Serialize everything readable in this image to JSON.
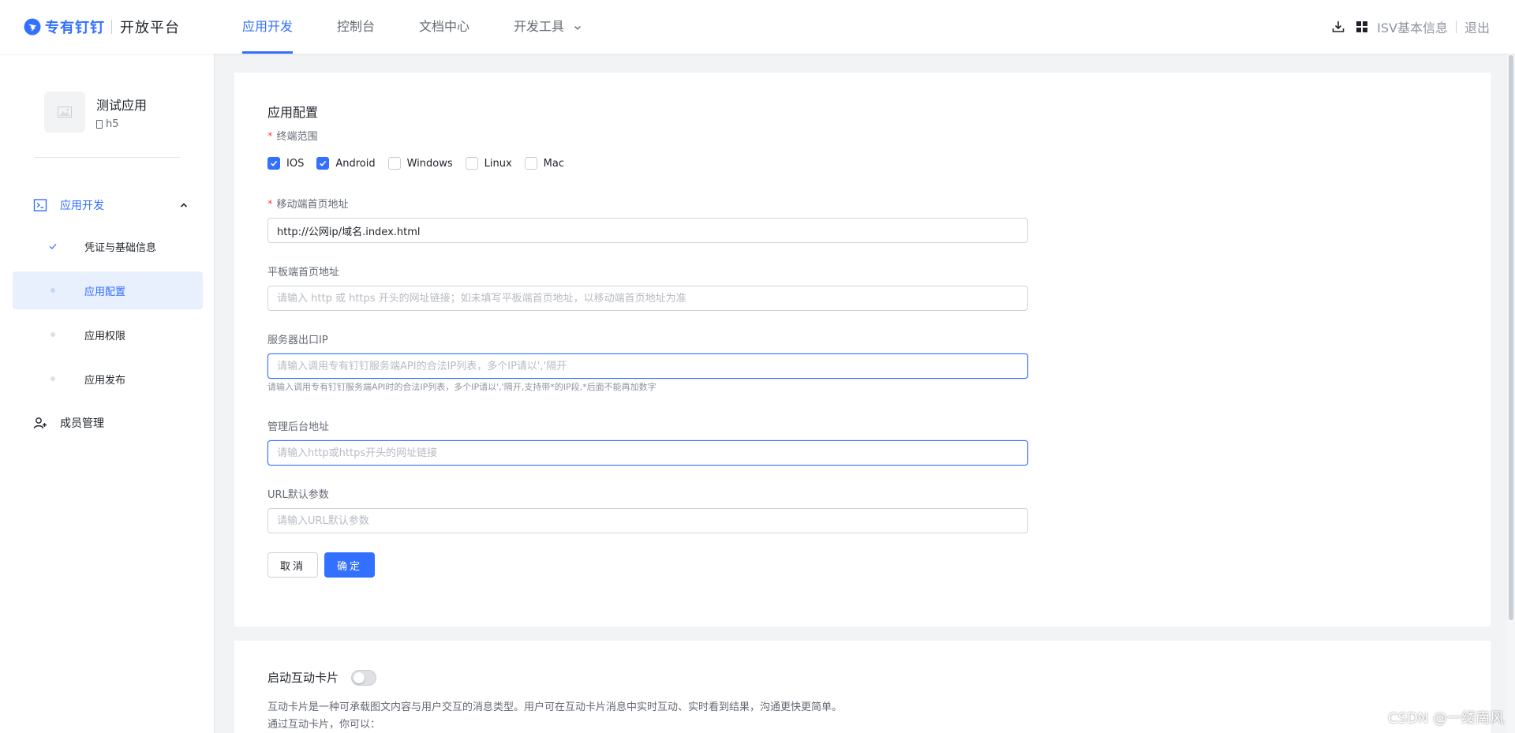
{
  "header": {
    "brand_name": "专有钉钉",
    "brand_sub": "开放平台",
    "tabs": [
      {
        "label": "应用开发",
        "active": true
      },
      {
        "label": "控制台",
        "active": false
      },
      {
        "label": "文档中心",
        "active": false
      },
      {
        "label": "开发工具",
        "active": false,
        "has_dropdown": true
      }
    ],
    "right": {
      "icons": [
        "download-icon",
        "grid-apps-icon"
      ],
      "isv_label": "ISV基本信息",
      "logout_label": "退出"
    }
  },
  "sidebar": {
    "app_name": "测试应用",
    "app_type": "h5",
    "groups": [
      {
        "label": "应用开发",
        "icon": "terminal-icon",
        "expanded": true,
        "items": [
          {
            "label": "凭证与基础信息",
            "status": "done"
          },
          {
            "label": "应用配置",
            "status": "active"
          },
          {
            "label": "应用权限",
            "status": "pending"
          },
          {
            "label": "应用发布",
            "status": "pending"
          }
        ]
      },
      {
        "label": "成员管理",
        "icon": "add-user-icon",
        "expanded": false
      }
    ]
  },
  "config": {
    "title": "应用配置",
    "terminal_range": {
      "label": "终端范围",
      "required": true,
      "options": [
        {
          "label": "IOS",
          "checked": true
        },
        {
          "label": "Android",
          "checked": true
        },
        {
          "label": "Windows",
          "checked": false
        },
        {
          "label": "Linux",
          "checked": false
        },
        {
          "label": "Mac",
          "checked": false
        }
      ]
    },
    "mobile_url": {
      "label": "移动端首页地址",
      "required": true,
      "value": "http://公网ip/域名.index.html"
    },
    "tablet_url": {
      "label": "平板端首页地址",
      "placeholder": "请输入 http 或 https 开头的网址链接；如未填写平板端首页地址，以移动端首页地址为准"
    },
    "server_ip": {
      "label": "服务器出口IP",
      "placeholder": "请输入调用专有钉钉服务端API的合法IP列表，多个IP请以','隔开",
      "hint": "请输入调用专有钉钉服务端API时的合法IP列表，多个IP请以','隔开,支持带*的IP段,*后面不能再加数字"
    },
    "admin_url": {
      "label": "管理后台地址",
      "placeholder": "请输入http或https开头的网址链接"
    },
    "url_params": {
      "label": "URL默认参数",
      "placeholder": "请输入URL默认参数"
    },
    "cancel_label": "取消",
    "confirm_label": "确定"
  },
  "interactive_card": {
    "title": "启动互动卡片",
    "enabled": false,
    "description": "互动卡片是一种可承载图文内容与用户交互的消息类型。用户可在互动卡片消息中实时互动、实时看到结果，沟通更快更简单。",
    "subtitle": "通过互动卡片，你可以："
  },
  "watermark": "CSDN @一缕南风",
  "colors": {
    "accent": "#3370ff",
    "active_bg": "#e8f0fe",
    "required": "#f54a45"
  }
}
